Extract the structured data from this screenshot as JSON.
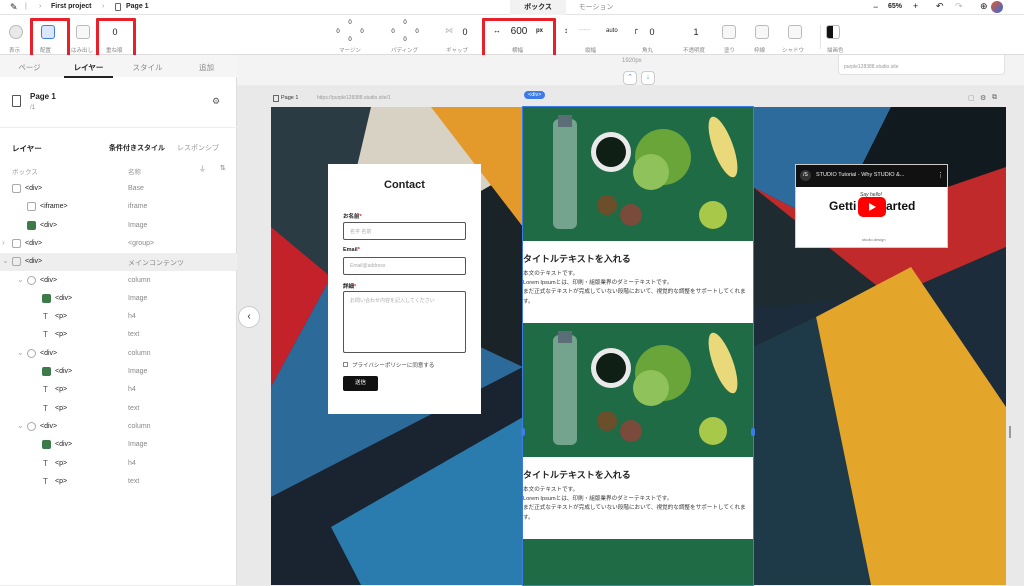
{
  "topbar": {
    "project": "First project",
    "page": "Page 1",
    "tab_box": "ボックス",
    "tab_motion": "モーション",
    "zoom": "65%",
    "minus": "−",
    "plus": "+"
  },
  "toolbar": {
    "display_label": "表示",
    "placement_label": "配置",
    "overflow_label": "はみ出し",
    "radius_value": "0",
    "radius_label": "重ね順",
    "margin_label": "マージン",
    "margin_vals": [
      "0",
      "0",
      "0",
      "0"
    ],
    "padding_label": "パディング",
    "padding_vals": [
      "0",
      "0",
      "0",
      "0"
    ],
    "gap_label": "ギャップ",
    "gap_value": "0",
    "width_value": "600",
    "width_unit": "px",
    "width_label": "横幅",
    "height_value": "-----",
    "height_unit": "auto",
    "height_label": "縦幅",
    "corner_value": "0",
    "corner_label": "角丸",
    "opacity_value": "1",
    "opacity_label": "不透明度",
    "fill_label": "塗り",
    "border_label": "枠線",
    "shadow_label": "シャドウ",
    "blend_label": "描画色"
  },
  "canvas": {
    "width_badge": "1920px",
    "url_right": "purple128388.studio.site",
    "page_label": "Page 1",
    "url_left": "https://purple128388.studio.site/1",
    "div_badge": "<div>"
  },
  "sidebar": {
    "tabs": [
      "ページ",
      "レイヤー",
      "スタイル",
      "追加"
    ],
    "page_title": "Page 1",
    "page_path": "/1",
    "layer_title": "レイヤー",
    "cond_style": "条件付きスタイル",
    "responsive": "レスポンシブ",
    "col_box": "ボックス",
    "col_name": "名称",
    "rows": [
      {
        "name": "<div>",
        "type": "Base"
      },
      {
        "name": "<iframe>",
        "type": "iframe"
      },
      {
        "name": "<div>",
        "type": "Image"
      },
      {
        "name": "<div>",
        "type": "<group>"
      },
      {
        "name": "<div>",
        "type": "メインコンテンツ"
      },
      {
        "name": "<div>",
        "type": "column"
      },
      {
        "name": "<div>",
        "type": "Image"
      },
      {
        "name": "<p>",
        "type": "h4"
      },
      {
        "name": "<p>",
        "type": "text"
      },
      {
        "name": "<div>",
        "type": "column"
      },
      {
        "name": "<div>",
        "type": "Image"
      },
      {
        "name": "<p>",
        "type": "h4"
      },
      {
        "name": "<p>",
        "type": "text"
      },
      {
        "name": "<div>",
        "type": "column"
      },
      {
        "name": "<div>",
        "type": "Image"
      },
      {
        "name": "<p>",
        "type": "h4"
      },
      {
        "name": "<p>",
        "type": "text"
      }
    ]
  },
  "contact": {
    "title": "Contact",
    "name_label": "お名前",
    "name_placeholder": "名字 名前",
    "email_label": "Email",
    "email_placeholder": "Email@address",
    "detail_label": "詳細",
    "detail_placeholder": "お問い合わせ内容を記入してください",
    "privacy": "プライバシーポリシーに同意する",
    "submit": "送信"
  },
  "columns": [
    {
      "title": "タイトルテキストを入れる",
      "text": [
        "本文のテキストです。",
        "Lorem Ipsumとは、印刷・組版業界のダミーテキストです。",
        "まだ正式なテキストが完成していない段階において、視覚的な調整をサポートしてくれます。"
      ]
    },
    {
      "title": "タイトルテキストを入れる",
      "text": [
        "本文のテキストです。",
        "Lorem Ipsumとは、印刷・組版業界のダミーテキストです。",
        "まだ正式なテキストが完成していない段階において、視覚的な調整をサポートしてくれます。"
      ]
    }
  ],
  "video": {
    "title": "STUDIO Tutorial - Why STUDIO &...",
    "script": "Say hello!",
    "headline_left": "Getti",
    "headline_right": "arted",
    "footer": "studio.design"
  },
  "colors": {
    "accent_red": "#e8202a",
    "selection_blue": "#3d7be8",
    "youtube_red": "#ff0000"
  }
}
